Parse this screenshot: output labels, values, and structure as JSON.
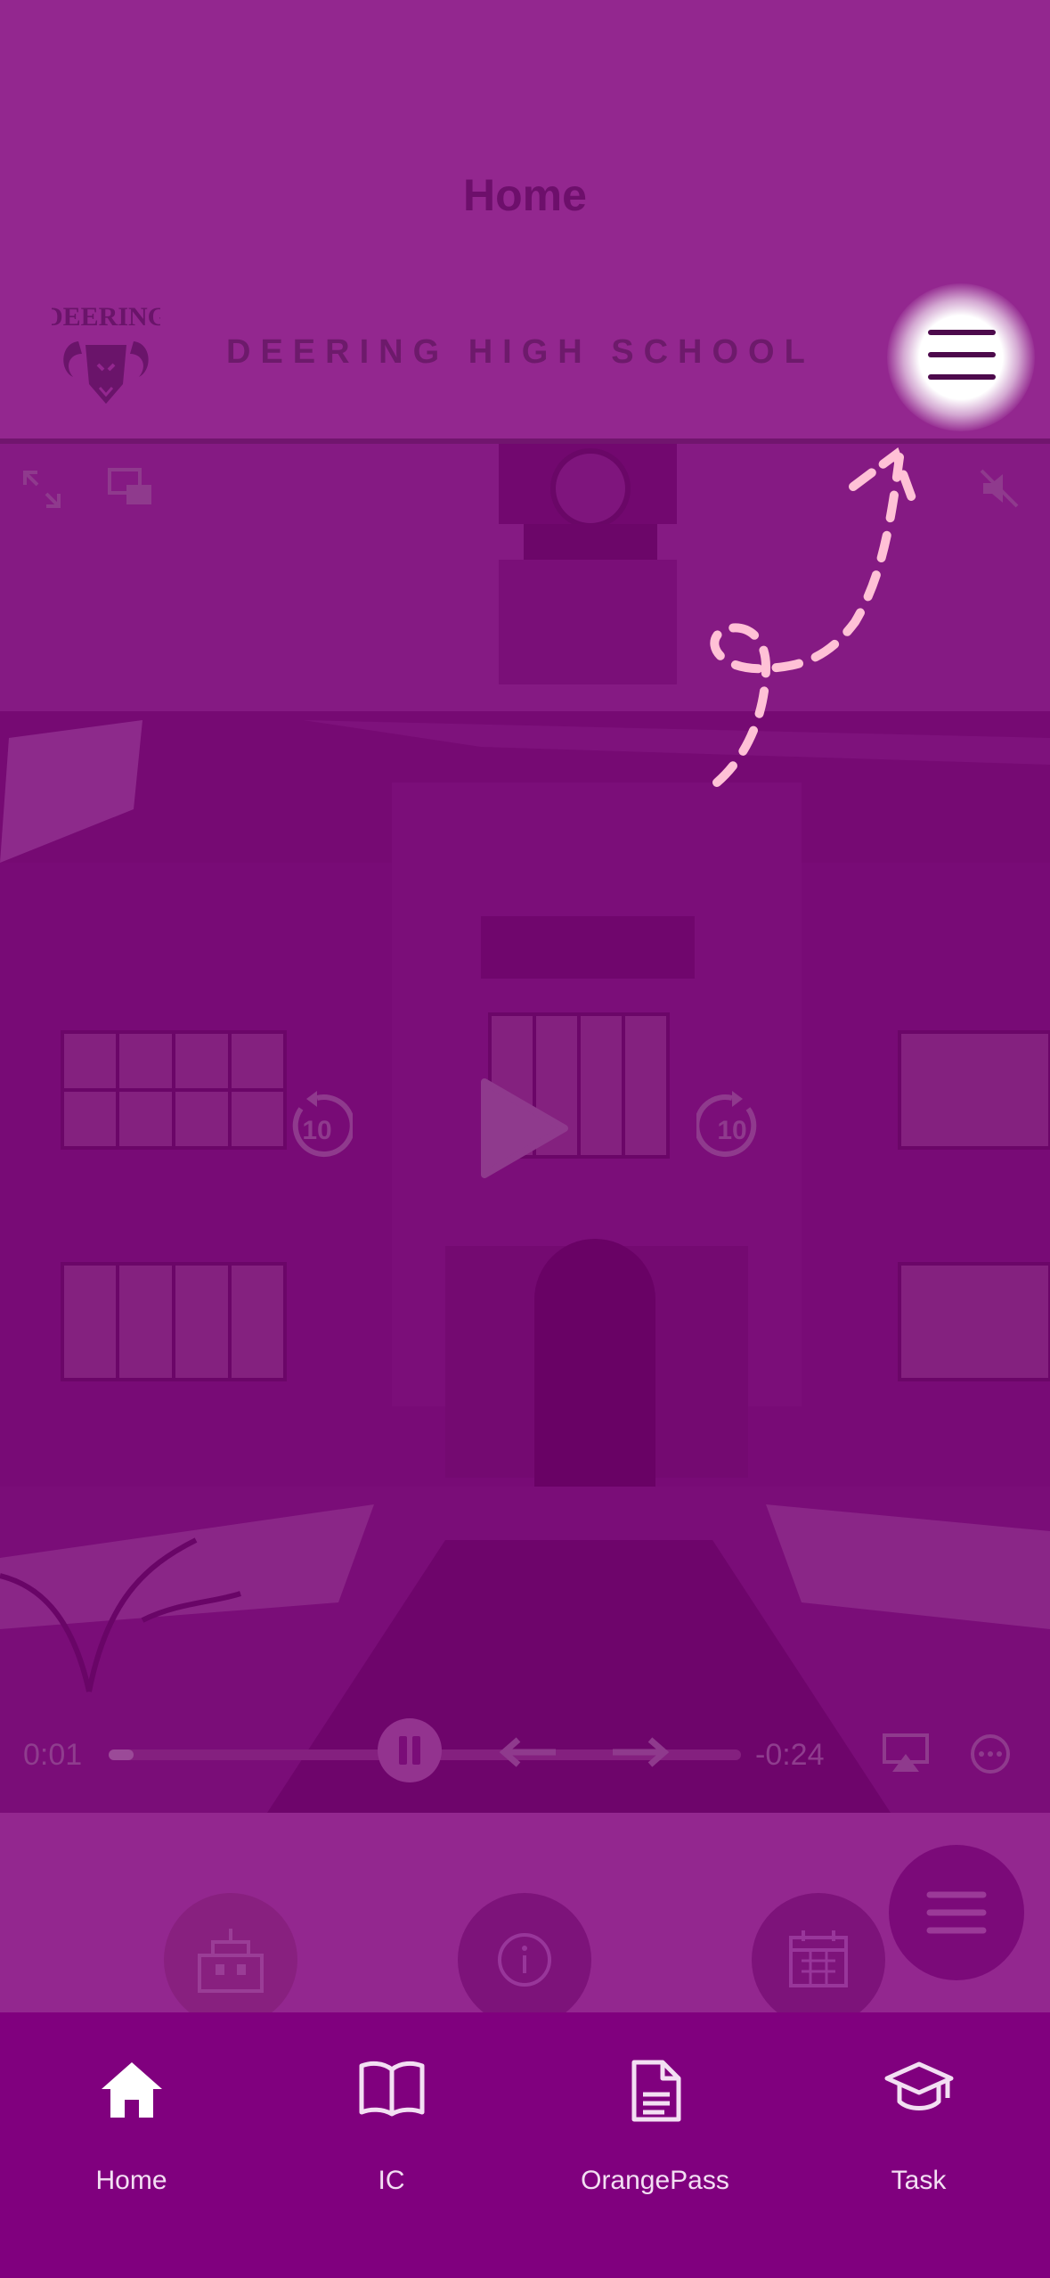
{
  "nav": {
    "title": "Home"
  },
  "header": {
    "school_name": "DEERING HIGH SCHOOL",
    "logo_text": "DEERING",
    "menu_icon": "hamburger-icon"
  },
  "video": {
    "time_elapsed": "0:01",
    "time_remaining": "-0:24",
    "skip_back_label": "10",
    "skip_forward_label": "10",
    "progress": 0.04
  },
  "quick_actions": [
    {
      "icon": "school-building-icon"
    },
    {
      "icon": "info-icon"
    },
    {
      "icon": "calendar-icon"
    }
  ],
  "fab": {
    "icon": "menu-lines-icon"
  },
  "tabs": [
    {
      "label": "Home",
      "icon": "home-icon",
      "active": true
    },
    {
      "label": "IC",
      "icon": "book-icon",
      "active": false
    },
    {
      "label": "OrangePass",
      "icon": "document-icon",
      "active": false
    },
    {
      "label": "Task",
      "icon": "graduation-cap-icon",
      "active": false
    }
  ],
  "colors": {
    "background": "#93278f",
    "tab_bar": "#80007e",
    "annotation_arrow": "#ffc1d6"
  }
}
